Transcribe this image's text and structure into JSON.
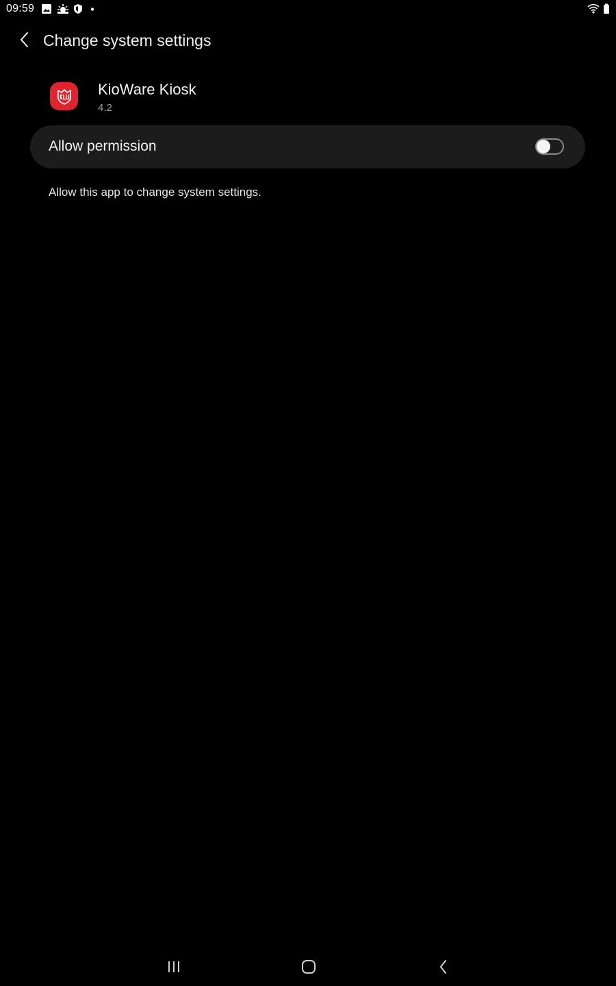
{
  "status_bar": {
    "time": "09:59",
    "icons": [
      "image-icon",
      "weather-icon",
      "shield-icon",
      "dot-icon",
      "wifi-icon",
      "battery-icon"
    ]
  },
  "header": {
    "title": "Change system settings",
    "back_icon": "chevron-left-icon"
  },
  "app": {
    "name": "KioWare Kiosk",
    "version": "4.2",
    "icon": "kioware-logo",
    "icon_color": "#e0242f"
  },
  "permission": {
    "label": "Allow permission",
    "enabled": false,
    "description": "Allow this app to change system settings."
  },
  "nav_bar": {
    "buttons": [
      "recent-apps-icon",
      "home-icon",
      "back-icon"
    ]
  },
  "colors": {
    "background": "#000000",
    "card": "#1c1c1c",
    "secondary_text": "#9a9a9a"
  }
}
